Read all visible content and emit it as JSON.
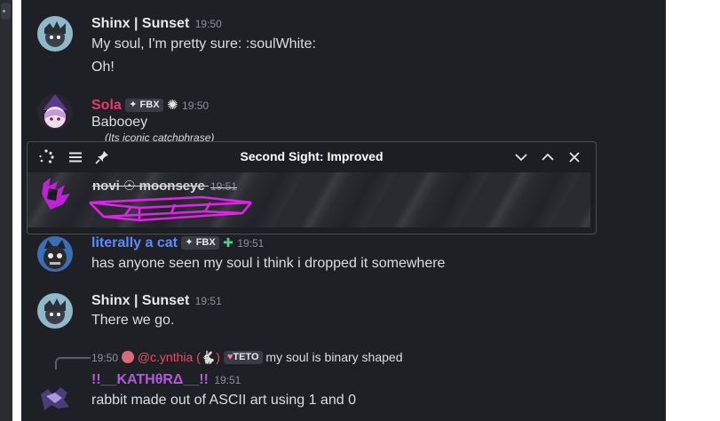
{
  "colors": {
    "chat_bg": "#1f2026",
    "text": "#dcdde1",
    "timestamp": "#8d9099",
    "name_default": "#e8e8ea",
    "name_sola": "#e13d6f",
    "name_cat": "#5a8cff",
    "name_kathrada": "#b15bd8",
    "mention": "#e34f65"
  },
  "messages": [
    {
      "author": "Shinx | Sunset",
      "time": "19:50",
      "lines": [
        "My soul, I'm pretty sure: :soulWhite:",
        "Oh!"
      ]
    },
    {
      "author": "Sola",
      "badge": "FBX",
      "time": "19:50",
      "lines": [
        "Babooey"
      ],
      "subtext": "(Its iconic catchphrase)"
    },
    {
      "author": "literally a cat",
      "badge": "FBX",
      "time": "19:51",
      "lines": [
        "has anyone seen my soul i think i dropped it somewhere"
      ]
    },
    {
      "author": "Shinx | Sunset",
      "time": "19:51",
      "lines": [
        "There we go."
      ]
    },
    {
      "author": "!!__KATHθRΔ__!!",
      "time": "19:51",
      "lines": [
        "rabbit made out of ASCII art using 1 and 0"
      ],
      "reply": {
        "time": "19:50",
        "author": "@c.ynthia",
        "pronoun_open": "(",
        "pronoun_close": ")",
        "badge": "TETO",
        "text": "my soul is binary shaped"
      }
    }
  ],
  "overlay": {
    "title": "Second Sight: Improved",
    "author": "novi ☉ moonseye",
    "time": "19:51",
    "icons": [
      "spinner-icon",
      "menu-icon",
      "pin-icon",
      "chevron-down-icon",
      "chevron-up-icon",
      "close-icon"
    ]
  }
}
